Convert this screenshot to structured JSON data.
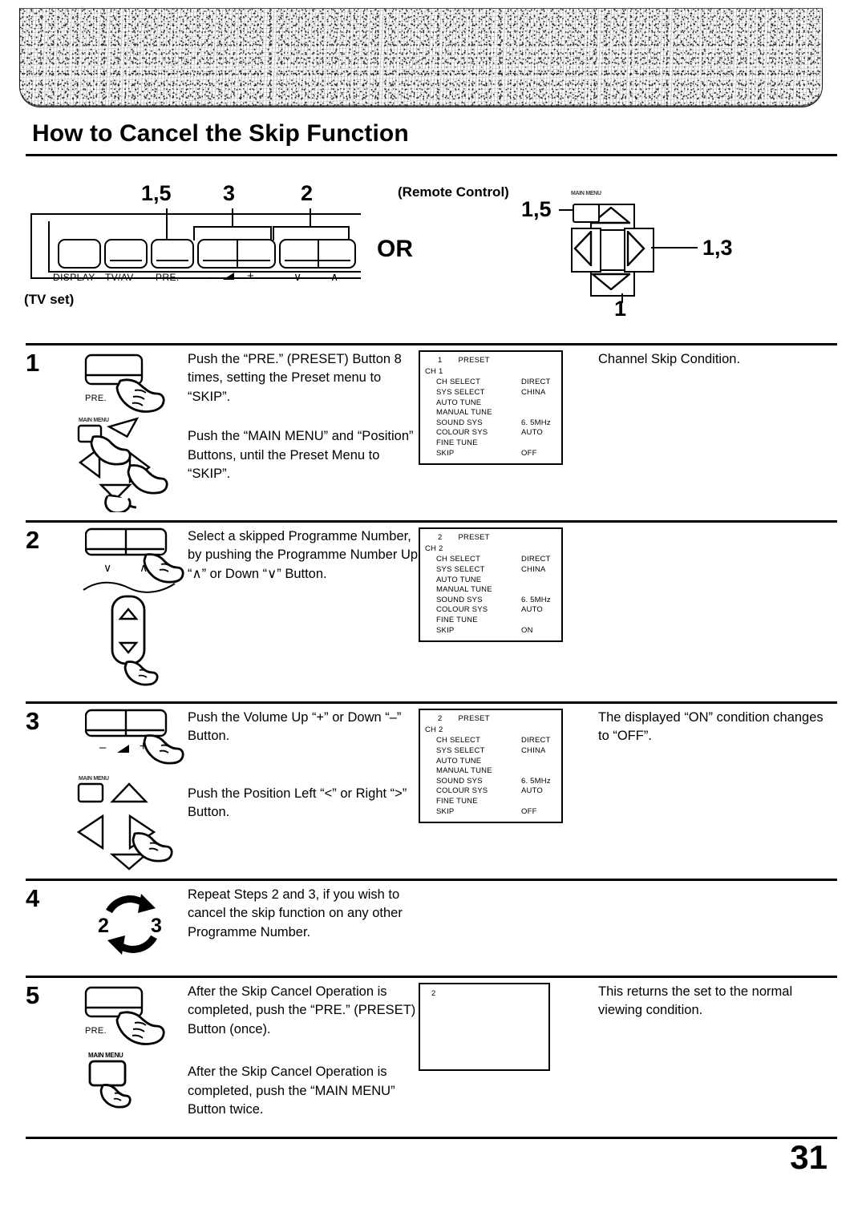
{
  "document": {
    "title": "How to Cancel the Skip Function",
    "page_number": "31"
  },
  "diagram": {
    "tv_set_caption": "(TV set)",
    "remote_caption": "(Remote Control)",
    "or_label": "OR",
    "tv_callouts": {
      "pre": "1,5",
      "volume": "3",
      "channel": "2"
    },
    "remote_callouts": {
      "main_menu": "1,5",
      "left_right": "1,3",
      "down": "1"
    },
    "tv_buttons": [
      {
        "label": "DISPLAY"
      },
      {
        "label": "TV/AV"
      },
      {
        "label": "PRE."
      },
      {
        "label": "-"
      },
      {
        "label": "+"
      },
      {
        "label": "∨"
      },
      {
        "label": "∧"
      }
    ],
    "remote_main_menu_label": "MAIN MENU"
  },
  "steps": [
    {
      "number": "1",
      "instructions": [
        "Push the “PRE.” (PRESET) Button 8 times, setting the Preset menu to “SKIP”.",
        "Push the “MAIN MENU” and “Position” Buttons, until the Preset Menu to “SKIP”."
      ],
      "illustration_labels": {
        "button": "PRE.",
        "menu_button": "MAIN MENU"
      },
      "osd": {
        "index": "1",
        "title": "PRESET",
        "channel": "CH 1",
        "rows": [
          {
            "label": "CH  SELECT",
            "value": "DIRECT"
          },
          {
            "label": "SYS  SELECT",
            "value": "CHINA"
          },
          {
            "label": "AUTO  TUNE",
            "value": ""
          },
          {
            "label": "MANUAL TUNE",
            "value": ""
          },
          {
            "label": "SOUND  SYS",
            "value": "6. 5MHz"
          },
          {
            "label": "COLOUR SYS",
            "value": "AUTO"
          },
          {
            "label": "FINE TUNE",
            "value": ""
          },
          {
            "label": "SKIP",
            "value": "OFF"
          }
        ]
      },
      "note": "Channel Skip Condition."
    },
    {
      "number": "2",
      "instructions": [
        "Select a skipped Programme Number, by pushing the Programme Number Up “∧” or Down “∨” Button."
      ],
      "illustration_labels": {
        "down": "∨",
        "up": "∧"
      },
      "osd": {
        "index": "2",
        "title": "PRESET",
        "channel": "CH 2",
        "rows": [
          {
            "label": "CH  SELECT",
            "value": "DIRECT"
          },
          {
            "label": "SYS  SELECT",
            "value": "CHINA"
          },
          {
            "label": "AUTO  TUNE",
            "value": ""
          },
          {
            "label": "MANUAL TUNE",
            "value": ""
          },
          {
            "label": "SOUND  SYS",
            "value": "6. 5MHz"
          },
          {
            "label": "COLOUR SYS",
            "value": "AUTO"
          },
          {
            "label": "FINE TUNE",
            "value": ""
          },
          {
            "label": "SKIP",
            "value": "ON"
          }
        ]
      },
      "note": ""
    },
    {
      "number": "3",
      "instructions": [
        "Push the Volume Up “+” or Down “–” Button.",
        "Push the Position Left “<” or Right “>” Button."
      ],
      "illustration_labels": {
        "minus": "–",
        "plus": "+",
        "menu_button": "MAIN MENU"
      },
      "osd": {
        "index": "2",
        "title": "PRESET",
        "channel": "CH 2",
        "rows": [
          {
            "label": "CH  SELECT",
            "value": "DIRECT"
          },
          {
            "label": "SYS  SELECT",
            "value": "CHINA"
          },
          {
            "label": "AUTO  TUNE",
            "value": ""
          },
          {
            "label": "MANUAL TUNE",
            "value": ""
          },
          {
            "label": "SOUND  SYS",
            "value": "6. 5MHz"
          },
          {
            "label": "COLOUR SYS",
            "value": "AUTO"
          },
          {
            "label": "FINE TUNE",
            "value": ""
          },
          {
            "label": "SKIP",
            "value": "OFF"
          }
        ]
      },
      "note": "The displayed “ON” condition changes to “OFF”."
    },
    {
      "number": "4",
      "instructions": [
        "Repeat Steps 2 and 3, if you wish to cancel the skip function on any other Programme Number."
      ],
      "illustration_labels": {
        "left": "2",
        "right": "3"
      },
      "osd": null,
      "note": ""
    },
    {
      "number": "5",
      "instructions": [
        "After the Skip Cancel Operation is completed, push the “PRE.” (PRESET) Button (once).",
        "After the Skip Cancel Operation is completed, push the “MAIN MENU” Button twice."
      ],
      "illustration_labels": {
        "button": "PRE.",
        "menu_button": "MAIN MENU"
      },
      "osd_blank": {
        "index": "2"
      },
      "note": "This returns the set to the normal viewing condition."
    }
  ]
}
